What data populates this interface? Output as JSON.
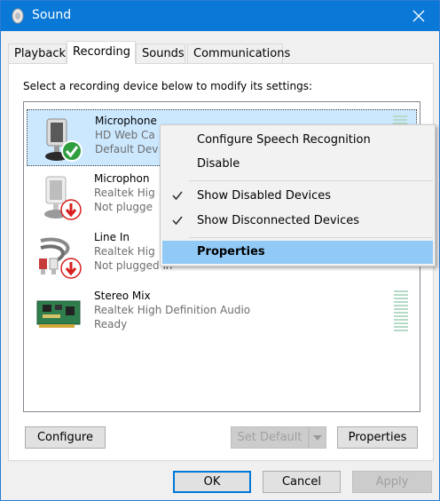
{
  "window": {
    "title": "Sound",
    "app_icon": "speaker-icon",
    "close_icon": "close-icon"
  },
  "tabs": [
    {
      "label": "Playback"
    },
    {
      "label": "Recording"
    },
    {
      "label": "Sounds"
    },
    {
      "label": "Communications"
    }
  ],
  "active_tab": "Recording",
  "instructions": "Select a recording device below to modify its settings:",
  "devices": [
    {
      "name": "Microphone",
      "description": "HD Web Ca",
      "status": "Default Dev",
      "icon": "microphone-icon",
      "badge": "check-badge-icon"
    },
    {
      "name": "Microphon",
      "description": "Realtek Hig",
      "status": "Not plugge",
      "icon": "microphone-icon",
      "badge": "down-arrow-badge-icon"
    },
    {
      "name": "Line In",
      "description": "Realtek Hig",
      "status": "Not plugged in",
      "icon": "line-in-cable-icon",
      "badge": "down-arrow-badge-icon"
    },
    {
      "name": "Stereo Mix",
      "description": "Realtek High Definition Audio",
      "status": "Ready",
      "icon": "sound-card-icon",
      "badge": ""
    }
  ],
  "context_menu": {
    "items": [
      {
        "label": "Configure Speech Recognition",
        "checked": false,
        "highlighted": false,
        "bold": false
      },
      {
        "label": "Disable",
        "checked": false,
        "highlighted": false,
        "bold": false
      },
      {
        "label": "Show Disabled Devices",
        "checked": true,
        "highlighted": false,
        "bold": false
      },
      {
        "label": "Show Disconnected Devices",
        "checked": true,
        "highlighted": false,
        "bold": false
      },
      {
        "label": "Properties",
        "checked": false,
        "highlighted": true,
        "bold": true
      }
    ]
  },
  "buttons": {
    "configure": "Configure",
    "set_default": "Set Default",
    "properties": "Properties",
    "ok": "OK",
    "cancel": "Cancel",
    "apply": "Apply"
  },
  "colors": {
    "titlebar": "#0a78d7",
    "selection": "#cce8ff",
    "menu_highlight": "#91c9f7",
    "check_green": "#2e9e3e",
    "arrow_red": "#d81e1e"
  }
}
